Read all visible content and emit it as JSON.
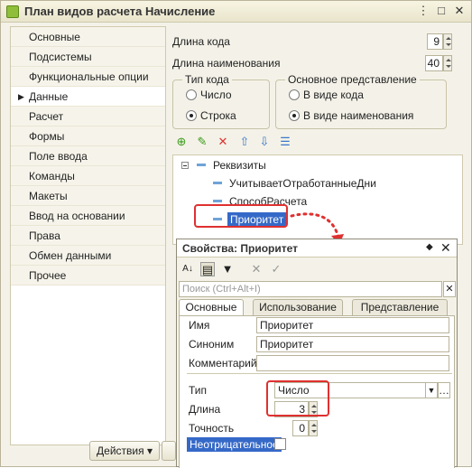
{
  "window": {
    "title": "План видов расчета Начисление"
  },
  "nav": {
    "items": [
      {
        "label": "Основные"
      },
      {
        "label": "Подсистемы"
      },
      {
        "label": "Функциональные опции"
      },
      {
        "label": "Данные"
      },
      {
        "label": "Расчет"
      },
      {
        "label": "Формы"
      },
      {
        "label": "Поле ввода"
      },
      {
        "label": "Команды"
      },
      {
        "label": "Макеты"
      },
      {
        "label": "Ввод на основании"
      },
      {
        "label": "Права"
      },
      {
        "label": "Обмен данными"
      },
      {
        "label": "Прочее"
      }
    ],
    "active_index": 3
  },
  "form": {
    "code_length_label": "Длина кода",
    "code_length_value": "9",
    "name_length_label": "Длина наименования",
    "name_length_value": "40",
    "code_type": {
      "title": "Тип кода",
      "options": [
        "Число",
        "Строка"
      ],
      "selected": "Строка"
    },
    "main_presentation": {
      "title": "Основное представление",
      "options": [
        "В виде кода",
        "В виде наименования"
      ],
      "selected": "В виде наименования"
    }
  },
  "tree": {
    "root": "Реквизиты",
    "children": [
      "УчитываетОтработанныеДни",
      "СпособРасчета",
      "Приоритет"
    ],
    "selected": "Приоритет"
  },
  "bottom": {
    "actions_label": "Действия"
  },
  "properties": {
    "title": "Свойства: Приоритет",
    "search_placeholder": "Поиск (Ctrl+Alt+I)",
    "tabs": [
      "Основные",
      "Использование",
      "Представление"
    ],
    "active_tab": "Основные",
    "name_label": "Имя",
    "name_value": "Приоритет",
    "synonym_label": "Синоним",
    "synonym_value": "Приоритет",
    "comment_label": "Комментарий",
    "comment_value": "",
    "type_label": "Тип",
    "type_value": "Число",
    "length_label": "Длина",
    "length_value": "3",
    "precision_label": "Точность",
    "precision_value": "0",
    "nonnegative_label": "Неотрицательное"
  },
  "colors": {
    "highlight": "#e03030",
    "selection": "#3569c8"
  }
}
